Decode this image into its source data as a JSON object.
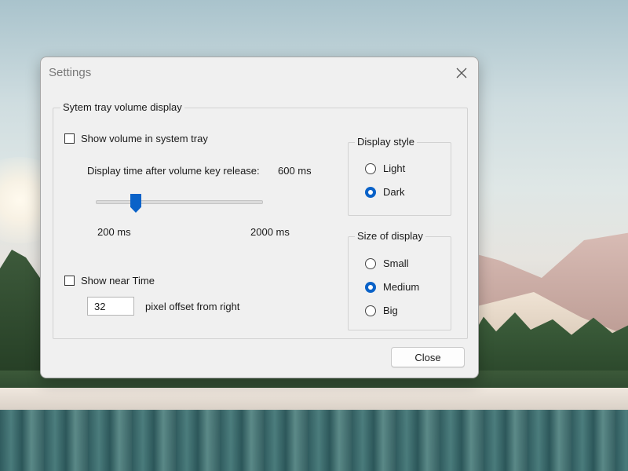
{
  "window": {
    "title": "Settings"
  },
  "tray_group": {
    "legend": "Sytem tray volume display",
    "show_volume_label": "Show volume in system tray",
    "show_volume_checked": false,
    "display_time_label": "Display time after volume key release:",
    "display_time_value": "600 ms",
    "slider": {
      "min_label": "200 ms",
      "max_label": "2000 ms",
      "value_ms": 600,
      "min_ms": 200,
      "max_ms": 2000
    },
    "show_near_time_label": "Show near Time",
    "show_near_time_checked": false,
    "pixel_offset_value": "32",
    "pixel_offset_label": "pixel offset from right"
  },
  "display_style": {
    "legend": "Display style",
    "options": [
      {
        "label": "Light",
        "selected": false
      },
      {
        "label": "Dark",
        "selected": true
      }
    ]
  },
  "size_of_display": {
    "legend": "Size of display",
    "options": [
      {
        "label": "Small",
        "selected": false
      },
      {
        "label": "Medium",
        "selected": true
      },
      {
        "label": "Big",
        "selected": false
      }
    ]
  },
  "footer": {
    "close_label": "Close"
  },
  "colors": {
    "accent": "#0a62c8",
    "window_bg": "#f0f0f0"
  }
}
